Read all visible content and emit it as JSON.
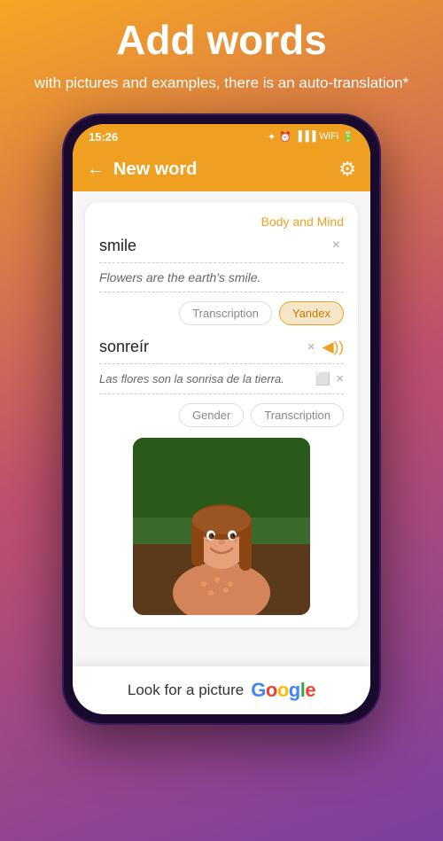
{
  "promo": {
    "title": "Add words",
    "subtitle": "with pictures and examples,\nthere is an auto-translation*"
  },
  "statusBar": {
    "time": "15:26",
    "icons": "🔵 ⏰ .ull VoWiFi 🔋"
  },
  "header": {
    "title": "New word",
    "backLabel": "←",
    "settingsIcon": "⚙"
  },
  "card": {
    "categoryLabel": "Body and Mind",
    "wordValue": "smile",
    "wordClearIcon": "×",
    "exampleText": "Flowers are the earth's smile.",
    "transcriptionLabel": "Transcription",
    "yandexLabel": "Yandex",
    "translationValue": "sonreír",
    "translationClearIcon": "×",
    "translationSoundIcon": "◀))",
    "translationExample": "Las flores son la sonrisa de la tierra.",
    "copyIcon": "⬜",
    "translationClearIcon2": "×",
    "genderLabel": "Gender",
    "transcriptionLabel2": "Transcription"
  },
  "bottomBar": {
    "searchText": "Look for a picture",
    "googleLogo": {
      "g1": "G",
      "g2": "o",
      "g3": "o",
      "g4": "g",
      "g5": "l",
      "g6": "e"
    }
  }
}
